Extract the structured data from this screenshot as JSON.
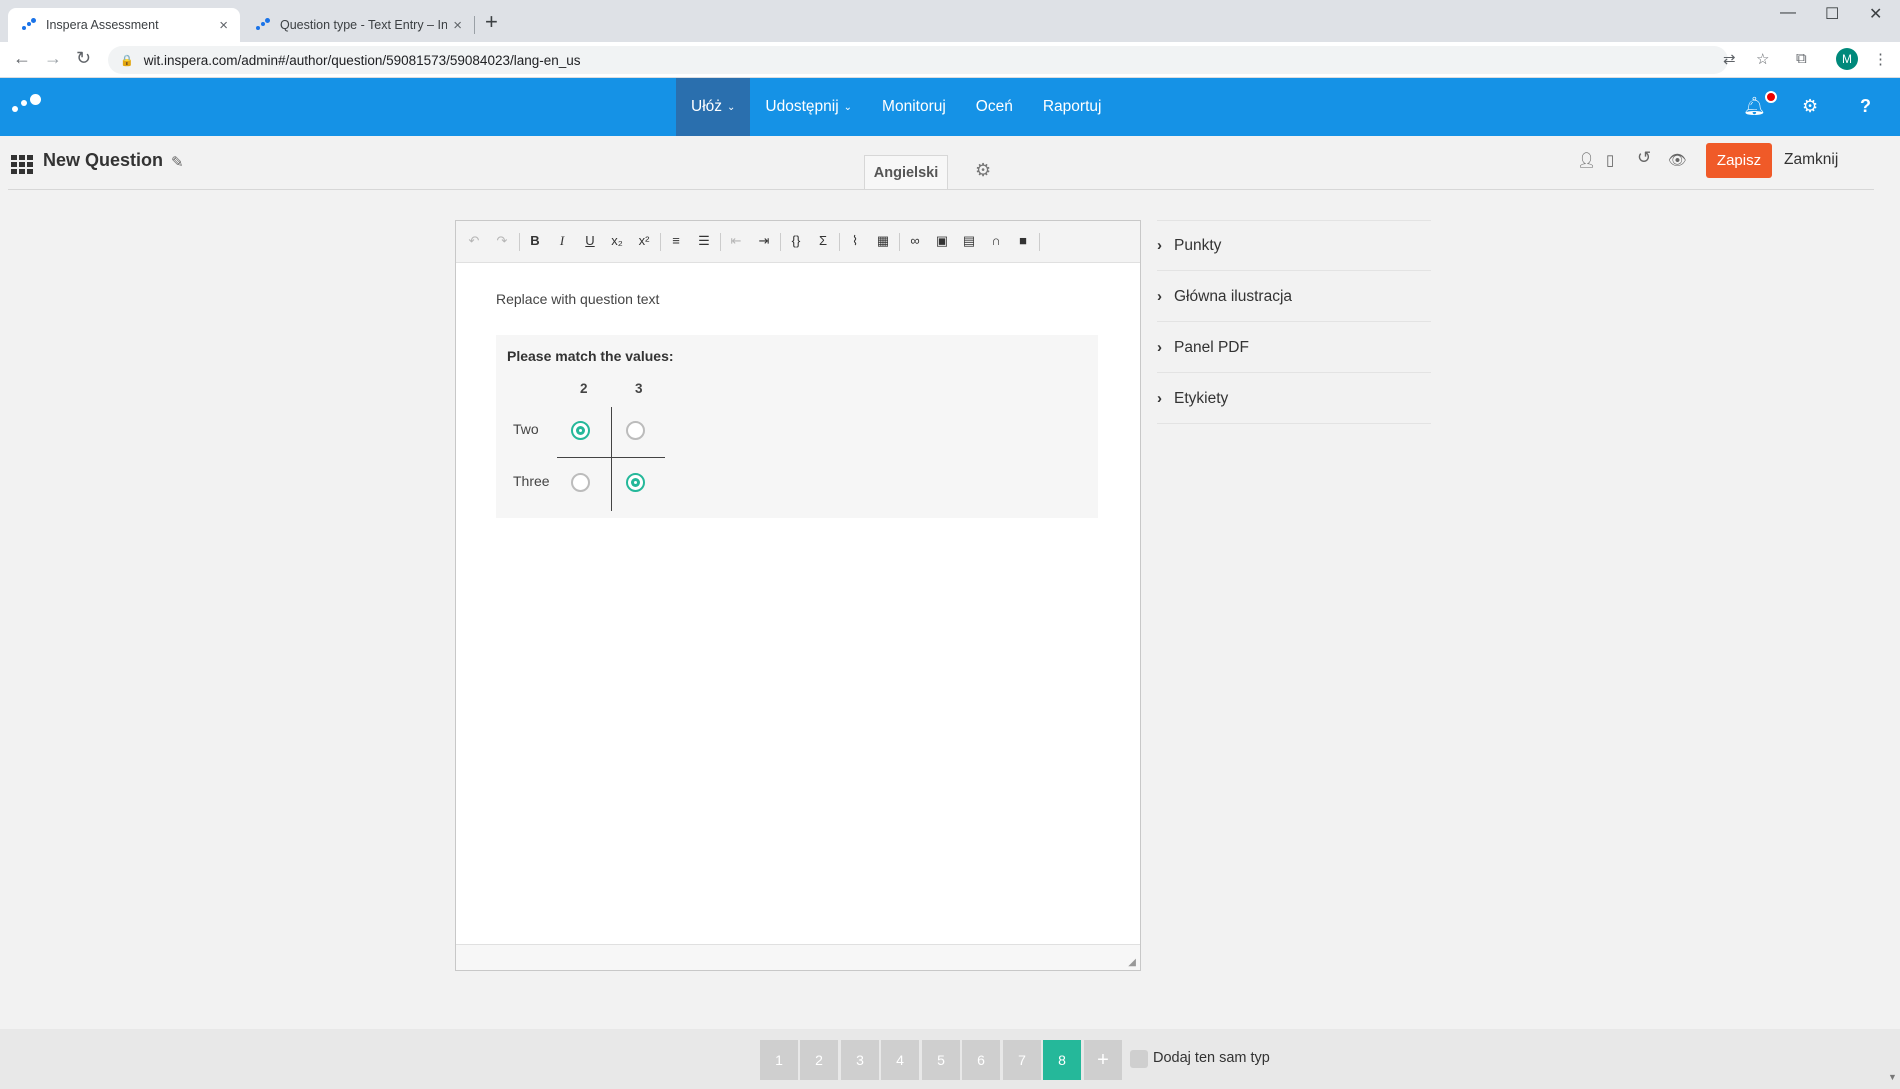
{
  "browser": {
    "tabs": [
      {
        "title": "Inspera Assessment",
        "close": "×"
      },
      {
        "title": "Question type - Text Entry – Insp",
        "close": "×"
      }
    ],
    "new_tab": "+",
    "window_controls": {
      "minimize": "—",
      "maximize": "☐",
      "close": "✕"
    },
    "url": "wit.inspera.com/admin#/author/question/59081573/59084023/lang-en_us",
    "profile_initial": "M"
  },
  "app": {
    "nav": [
      {
        "label": "Ułóż",
        "has_dropdown": true,
        "active": true
      },
      {
        "label": "Udostępnij",
        "has_dropdown": true,
        "active": false
      },
      {
        "label": "Monitoruj",
        "has_dropdown": false,
        "active": false
      },
      {
        "label": "Oceń",
        "has_dropdown": false,
        "active": false
      },
      {
        "label": "Raportuj",
        "has_dropdown": false,
        "active": false
      }
    ],
    "accent_color": "#1592e6"
  },
  "question": {
    "title": "New Question",
    "language_tab": "Angielski",
    "save_label": "Zapisz",
    "close_label": "Zamknij",
    "save_color": "#f05a28"
  },
  "editor": {
    "question_text": "Replace with question text",
    "match": {
      "prompt": "Please match the values:",
      "columns": [
        "2",
        "3"
      ],
      "rows": [
        {
          "label": "Two",
          "selected": [
            true,
            false
          ]
        },
        {
          "label": "Three",
          "selected": [
            false,
            true
          ]
        }
      ],
      "selected_color": "#25b89a"
    }
  },
  "panel": {
    "items": [
      "Punkty",
      "Główna ilustracja",
      "Panel PDF",
      "Etykiety"
    ]
  },
  "footer": {
    "pages": [
      "1",
      "2",
      "3",
      "4",
      "5",
      "6",
      "7",
      "8"
    ],
    "current_page": "8",
    "add_symbol": "+",
    "same_type_label": "Dodaj ten sam typ",
    "active_color": "#25b89a"
  }
}
